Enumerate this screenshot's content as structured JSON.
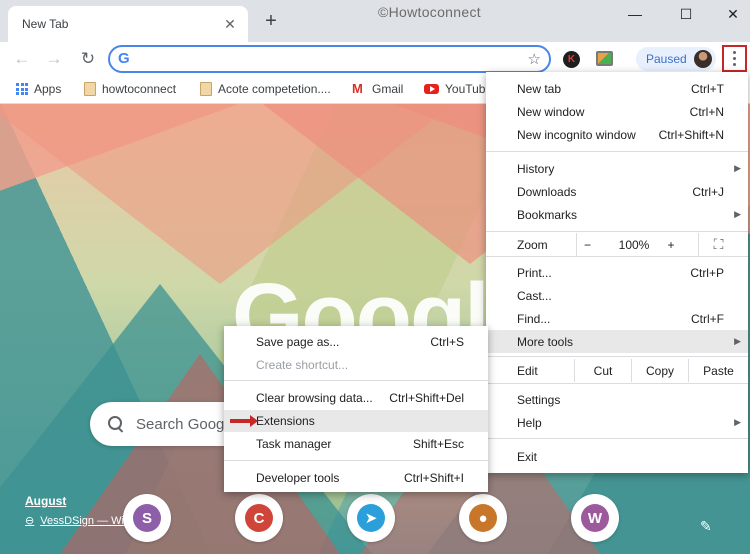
{
  "browser": {
    "tab_title": "New Tab",
    "tab_close": "✕",
    "new_tab": "+",
    "watermark": "©Howtoconnect",
    "win_min": "—",
    "win_max": "☐",
    "win_close": "✕"
  },
  "toolbar": {
    "back": "←",
    "forward": "→",
    "reload": "↻",
    "omnibox_value": "",
    "star": "☆",
    "ext_k": "K",
    "paused": "Paused"
  },
  "bookmarks": [
    {
      "label": "Apps",
      "icon": "apps-grid-icon"
    },
    {
      "label": "howtoconnect",
      "icon": "folder-icon"
    },
    {
      "label": "Acote competetion....",
      "icon": "folder-icon"
    },
    {
      "label": "Gmail",
      "icon": "gmail-icon"
    },
    {
      "label": "YouTube",
      "icon": "youtube-icon"
    }
  ],
  "page": {
    "logo_text": "Google",
    "search_placeholder": "Search Google",
    "attribution_title": "August",
    "attribution_link": "VessDSign — Wiki",
    "tiles": [
      {
        "letter": "S",
        "color": "#8e5fa8"
      },
      {
        "letter": "C",
        "color": "#d0453a"
      },
      {
        "letter": "",
        "color": "#2b9fd9"
      },
      {
        "letter": "",
        "color": "#c8772a"
      },
      {
        "letter": "W",
        "color": "#9c5a9c"
      }
    ]
  },
  "main_menu": {
    "new_tab": {
      "label": "New tab",
      "shortcut": "Ctrl+T"
    },
    "new_window": {
      "label": "New window",
      "shortcut": "Ctrl+N"
    },
    "incognito": {
      "label": "New incognito window",
      "shortcut": "Ctrl+Shift+N"
    },
    "history": {
      "label": "History"
    },
    "downloads": {
      "label": "Downloads",
      "shortcut": "Ctrl+J"
    },
    "bookmarks": {
      "label": "Bookmarks"
    },
    "zoom": {
      "label": "Zoom",
      "minus": "−",
      "value": "100%",
      "plus": "+",
      "fullscreen": "⛶"
    },
    "print": {
      "label": "Print...",
      "shortcut": "Ctrl+P"
    },
    "cast": {
      "label": "Cast..."
    },
    "find": {
      "label": "Find...",
      "shortcut": "Ctrl+F"
    },
    "more_tools": {
      "label": "More tools"
    },
    "edit": {
      "label": "Edit",
      "cut": "Cut",
      "copy": "Copy",
      "paste": "Paste"
    },
    "settings": {
      "label": "Settings"
    },
    "help": {
      "label": "Help"
    },
    "exit": {
      "label": "Exit"
    }
  },
  "more_tools_menu": {
    "save_page": {
      "label": "Save page as...",
      "shortcut": "Ctrl+S"
    },
    "create_shortcut": {
      "label": "Create shortcut..."
    },
    "clear_data": {
      "label": "Clear browsing data...",
      "shortcut": "Ctrl+Shift+Del"
    },
    "extensions": {
      "label": "Extensions"
    },
    "task_manager": {
      "label": "Task manager",
      "shortcut": "Shift+Esc"
    },
    "dev_tools": {
      "label": "Developer tools",
      "shortcut": "Ctrl+Shift+I"
    }
  },
  "colors": {
    "accent": "#4a86e8",
    "highlight_border": "#c62828",
    "menu_hover": "#e8e8e8"
  }
}
